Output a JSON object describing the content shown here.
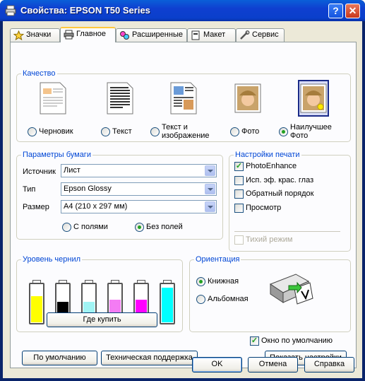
{
  "window": {
    "title": "Свойства: EPSON T50 Series",
    "help_glyph": "?",
    "close_glyph": "✕"
  },
  "tabs": [
    {
      "label": "Значки",
      "icon": "star-icon"
    },
    {
      "label": "Главное",
      "icon": "printer-icon",
      "active": true
    },
    {
      "label": "Расширенные",
      "icon": "gears-icon"
    },
    {
      "label": "Макет",
      "icon": "layout-icon"
    },
    {
      "label": "Сервис",
      "icon": "wrench-icon"
    }
  ],
  "quality": {
    "label": "Качество",
    "options": [
      {
        "label": "Черновик",
        "selected": false
      },
      {
        "label": "Текст",
        "selected": false
      },
      {
        "label": "Текст и изображение",
        "selected": false
      },
      {
        "label": "Фото",
        "selected": false
      },
      {
        "label": "Наилучшее Фото",
        "selected": true
      }
    ]
  },
  "paper": {
    "label": "Параметры бумаги",
    "source_label": "Источник",
    "source_value": "Лист",
    "type_label": "Тип",
    "type_value": "Epson Glossy",
    "size_label": "Размер",
    "size_value": "A4 (210 x 297 мм)",
    "border_options": [
      {
        "label": "С полями",
        "selected": false
      },
      {
        "label": "Без полей",
        "selected": true
      }
    ]
  },
  "print_settings": {
    "label": "Настройки печати",
    "options": [
      {
        "label": "PhotoEnhance",
        "checked": true
      },
      {
        "label": "Исп. эф. крас. глаз",
        "checked": false
      },
      {
        "label": "Обратный порядок",
        "checked": false
      },
      {
        "label": "Просмотр",
        "checked": false
      }
    ],
    "quiet_mode": {
      "label": "Тихий режим",
      "checked": false,
      "disabled": true
    }
  },
  "ink": {
    "label": "Уровень чернил",
    "cartridges": [
      {
        "name": "yellow",
        "color": "#ffff00",
        "level": 0.7
      },
      {
        "name": "black",
        "color": "#000000",
        "level": 0.55
      },
      {
        "name": "light-cyan",
        "color": "#a0f4f4",
        "level": 0.55
      },
      {
        "name": "light-magenta",
        "color": "#f47cf4",
        "level": 0.6
      },
      {
        "name": "magenta",
        "color": "#ff00ff",
        "level": 0.6
      },
      {
        "name": "cyan",
        "color": "#00ffff",
        "level": 0.92
      }
    ],
    "buy_button": "Где купить"
  },
  "orientation": {
    "label": "Ориентация",
    "options": [
      {
        "label": "Книжная",
        "selected": true
      },
      {
        "label": "Альбомная",
        "selected": false
      }
    ]
  },
  "default_window": {
    "label": "Окно по умолчанию",
    "checked": true
  },
  "buttons": {
    "defaults": "По умолчанию",
    "support": "Техническая поддержка",
    "show_settings": "Показать настройки",
    "ok": "OK",
    "cancel": "Отмена",
    "help": "Справка"
  },
  "colors": {
    "titlebar": "#0a3fcb",
    "group_label": "#0046d5",
    "dialog_face": "#ece9d8",
    "radio_dot": "#21a121"
  }
}
